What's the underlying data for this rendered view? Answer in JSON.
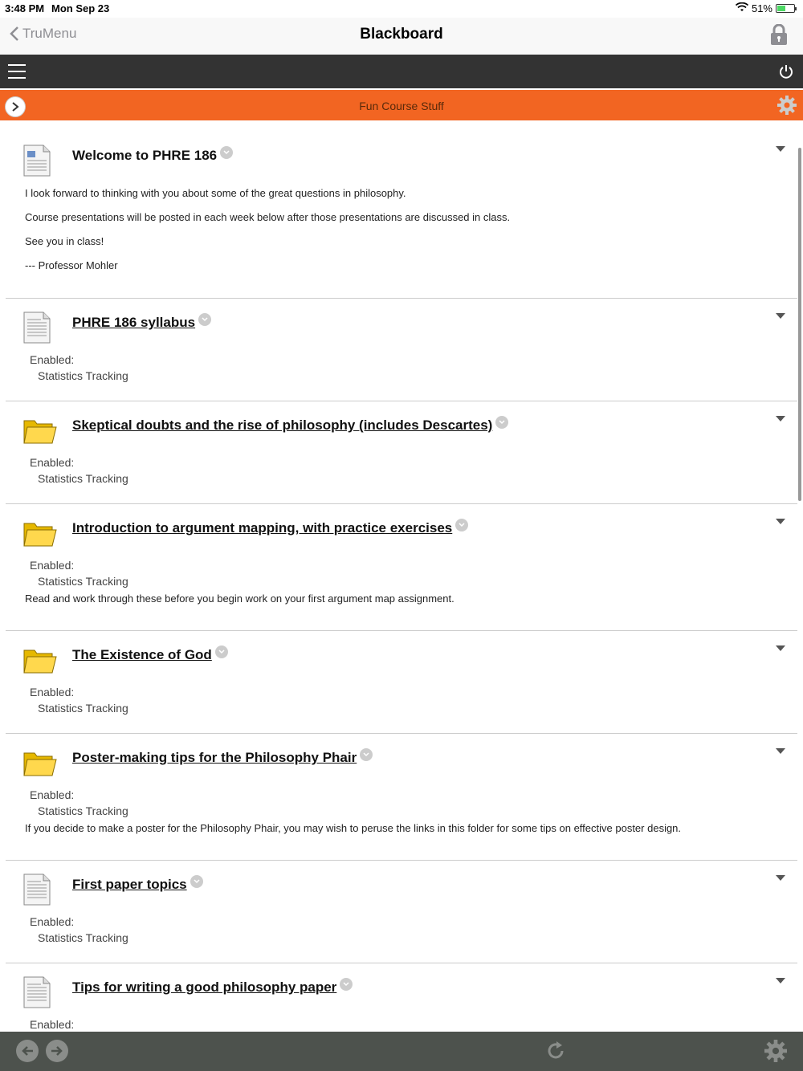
{
  "status": {
    "time": "3:48 PM",
    "date": "Mon Sep 23",
    "battery": "51%",
    "battery_level": 0.51
  },
  "nav": {
    "back_label": "TruMenu",
    "title": "Blackboard"
  },
  "course": {
    "name": "Fun Course Stuff"
  },
  "items": [
    {
      "title": "Welcome to PHRE 186",
      "icon": "document-icon",
      "paragraphs": [
        "I look forward to thinking with you about some of the great questions in philosophy.",
        "Course presentations will be posted in each week below after those presentations are discussed in class.",
        "See you in class!",
        "--- Professor Mohler"
      ]
    },
    {
      "title": "PHRE 186 syllabus",
      "icon": "document-icon",
      "enabled_label": "Enabled:",
      "tracking_label": "Statistics Tracking"
    },
    {
      "title": "Skeptical doubts and the rise of philosophy (includes Descartes)",
      "icon": "folder-icon",
      "enabled_label": "Enabled:",
      "tracking_label": "Statistics Tracking"
    },
    {
      "title": "Introduction to argument mapping, with practice exercises",
      "icon": "folder-icon",
      "enabled_label": "Enabled:",
      "tracking_label": "Statistics Tracking",
      "description": "Read and work through these before you begin work on your first argument map assignment."
    },
    {
      "title": "The Existence of God",
      "icon": "folder-icon",
      "enabled_label": "Enabled:",
      "tracking_label": "Statistics Tracking"
    },
    {
      "title": "Poster-making tips for the Philosophy Phair",
      "icon": "folder-icon",
      "enabled_label": "Enabled:",
      "tracking_label": "Statistics Tracking",
      "description": "If you decide to make a poster for the Philosophy Phair, you may wish to peruse the links in this folder for some tips on effective poster design."
    },
    {
      "title": "First paper topics",
      "icon": "document-icon",
      "enabled_label": "Enabled:",
      "tracking_label": "Statistics Tracking"
    },
    {
      "title": "Tips for writing a good philosophy paper",
      "icon": "document-icon",
      "enabled_label": "Enabled:"
    }
  ],
  "colors": {
    "accent_orange": "#f26522",
    "toolbar_dark": "#333333",
    "bottom_bar": "#4d524d"
  }
}
